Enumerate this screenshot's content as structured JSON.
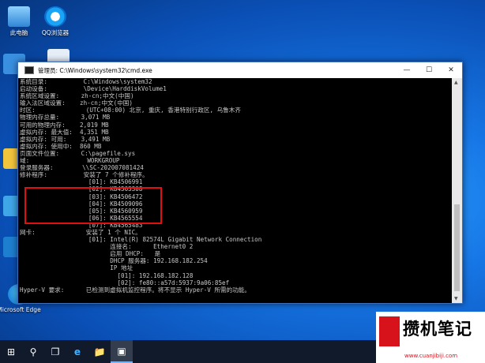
{
  "desktop": {
    "icons": [
      {
        "label": "此电脑",
        "icon": "computer-icon"
      },
      {
        "label": "QQ浏览器",
        "icon": "qq-browser-icon"
      },
      {
        "label": "Microsoft Edge",
        "icon": "edge-icon"
      }
    ]
  },
  "window": {
    "title": "管理员: C:\\Windows\\system32\\cmd.exe",
    "minimize": "—",
    "maximize": "☐",
    "close": "✕"
  },
  "console": {
    "lines": [
      "系统目录:          C:\\Windows\\system32",
      "启动设备:          \\Device\\HarddiskVolume1",
      "系统区域设置:      zh-cn;中文(中国)",
      "输入法区域设置:    zh-cn;中文(中国)",
      "时区:              (UTC+08:00) 北京, 重庆, 香港特别行政区, 乌鲁木齐",
      "物理内存总量:      3,071 MB",
      "可用的物理内存:    2,019 MB",
      "虚拟内存: 最大值:  4,351 MB",
      "虚拟内存: 可用:    3,491 MB",
      "虚拟内存: 使用中:  860 MB",
      "页面文件位置:      C:\\pagefile.sys",
      "域:                WORKGROUP",
      "登录服务器:        \\\\SC-202007081424",
      "修补程序:          安装了 7 个修补程序。",
      "                   [01]: KB4506991",
      "                   [02]: KB4503308",
      "                   [03]: KB4506472",
      "                   [04]: KB4509096",
      "                   [05]: KB4560959",
      "                   [06]: KB4565554",
      "                   [07]: KB4565483",
      "网卡:              安装了 1 个 NIC。",
      "                   [01]: Intel(R) 82574L Gigabit Network Connection",
      "                         连接名:      Ethernet0 2",
      "                         启用 DHCP:   是",
      "                         DHCP 服务器: 192.168.182.254",
      "                         IP 地址",
      "                           [01]: 192.168.182.128",
      "                           [02]: fe80::a57d:5937:9a06:85ef",
      "Hyper-V 要求:      已检测到虚拟机监控程序。将不显示 Hyper-V 所需的功能。"
    ]
  },
  "taskbar": {
    "start": "⊞",
    "search": "⚲",
    "task_view": "❐",
    "items": [
      "e",
      "📁",
      "▣"
    ]
  },
  "watermark": {
    "text": "攒机笔记",
    "url": "www.cuanjibiji.com"
  }
}
